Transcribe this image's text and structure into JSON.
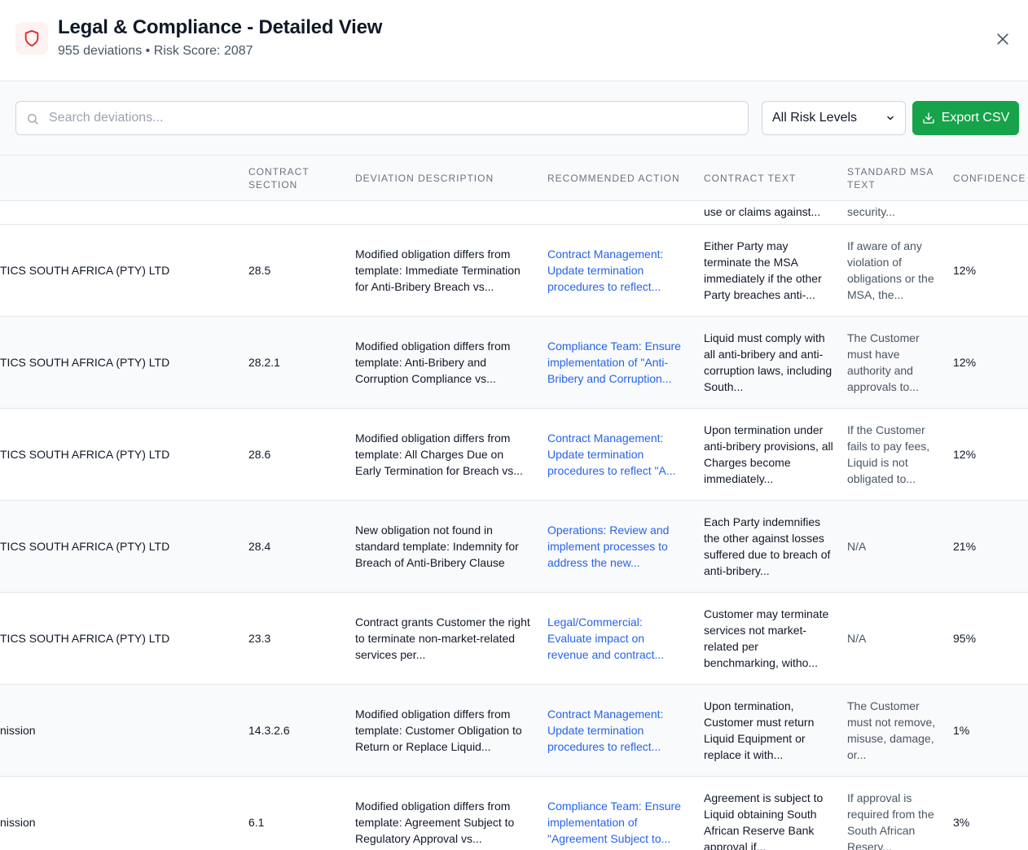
{
  "header": {
    "title": "Legal & Compliance - Detailed View",
    "deviation_count": "955 deviations",
    "risk_score": "Risk Score: 2087",
    "separator": "•"
  },
  "toolbar": {
    "search_placeholder": "Search deviations...",
    "risk_filter_selected": "All Risk Levels",
    "export_label": "Export CSV"
  },
  "colors": {
    "accent_green": "#16a34a",
    "link_blue": "#2563eb",
    "shield_red": "#dc2626"
  },
  "table": {
    "columns": [
      {
        "label": "CONTRACT SECTION"
      },
      {
        "label": "DEVIATION DESCRIPTION"
      },
      {
        "label": "RECOMMENDED ACTION"
      },
      {
        "label": "CONTRACT TEXT"
      },
      {
        "label": "STANDARD MSA TEXT"
      },
      {
        "label": "CONFIDENCE"
      }
    ],
    "partial_row": {
      "contract_text": "use or claims against...",
      "standard_text": "security..."
    },
    "rows": [
      {
        "party": "TICS SOUTH AFRICA (PTY) LTD",
        "section": "28.5",
        "description": "Modified obligation differs from template: Immediate Termination for Anti-Bribery Breach vs...",
        "action": "Contract Management: Update termination procedures to reflect...",
        "contract_text": "Either Party may terminate the MSA immediately if the other Party breaches anti-...",
        "standard_text": "If aware of any violation of obligations or the MSA, the...",
        "confidence": "12%"
      },
      {
        "party": "TICS SOUTH AFRICA (PTY) LTD",
        "section": "28.2.1",
        "description": "Modified obligation differs from template: Anti-Bribery and Corruption Compliance vs...",
        "action": "Compliance Team: Ensure implementation of \"Anti-Bribery and Corruption...",
        "contract_text": "Liquid must comply with all anti-bribery and anti-corruption laws, including South...",
        "standard_text": "The Customer must have authority and approvals to...",
        "confidence": "12%"
      },
      {
        "party": "TICS SOUTH AFRICA (PTY) LTD",
        "section": "28.6",
        "description": "Modified obligation differs from template: All Charges Due on Early Termination for Breach vs...",
        "action": "Contract Management: Update termination procedures to reflect \"A...",
        "contract_text": "Upon termination under anti-bribery provisions, all Charges become immediately...",
        "standard_text": "If the Customer fails to pay fees, Liquid is not obligated to...",
        "confidence": "12%"
      },
      {
        "party": "TICS SOUTH AFRICA (PTY) LTD",
        "section": "28.4",
        "description": "New obligation not found in standard template: Indemnity for Breach of Anti-Bribery Clause",
        "action": "Operations: Review and implement processes to address the new...",
        "contract_text": "Each Party indemnifies the other against losses suffered due to breach of anti-bribery...",
        "standard_text": "N/A",
        "confidence": "21%"
      },
      {
        "party": "TICS SOUTH AFRICA (PTY) LTD",
        "section": "23.3",
        "description": "Contract grants Customer the right to terminate non-market-related services per...",
        "action": "Legal/Commercial: Evaluate impact on revenue and contract...",
        "contract_text": "Customer may terminate services not market-related per benchmarking, witho...",
        "standard_text": "N/A",
        "confidence": "95%"
      },
      {
        "party": "nission",
        "section": "14.3.2.6",
        "description": "Modified obligation differs from template: Customer Obligation to Return or Replace Liquid...",
        "action": "Contract Management: Update termination procedures to reflect...",
        "contract_text": "Upon termination, Customer must return Liquid Equipment or replace it with...",
        "standard_text": "The Customer must not remove, misuse, damage, or...",
        "confidence": "1%"
      },
      {
        "party": "nission",
        "section": "6.1",
        "description": "Modified obligation differs from template: Agreement Subject to Regulatory Approval vs...",
        "action": "Compliance Team: Ensure implementation of \"Agreement Subject to...",
        "contract_text": "Agreement is subject to Liquid obtaining South African Reserve Bank approval if...",
        "standard_text": "If approval is required from the South African Reserv...",
        "confidence": "3%"
      }
    ]
  }
}
